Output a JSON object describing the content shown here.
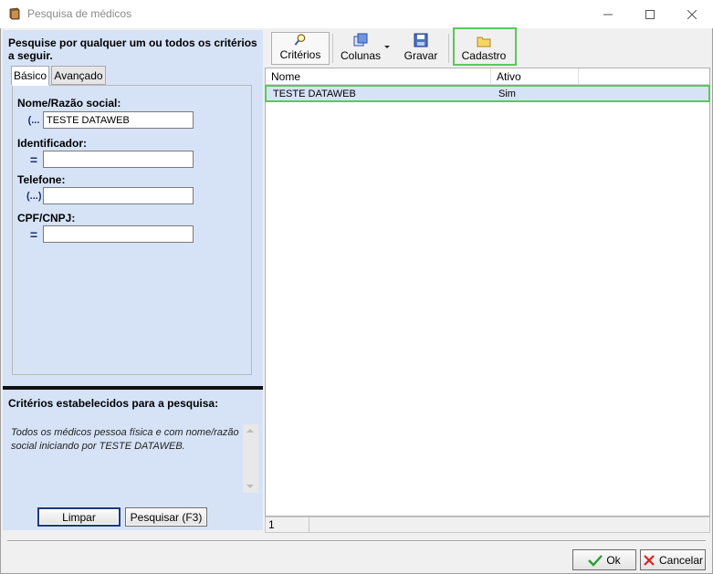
{
  "window": {
    "title": "Pesquisa de médicos",
    "icon": "book-icon"
  },
  "left": {
    "instructions": "Pesquise por qualquer um ou todos os critérios a seguir.",
    "tabs": [
      {
        "label": "Básico",
        "active": true
      },
      {
        "label": "Avançado",
        "active": false
      }
    ],
    "fields": [
      {
        "label": "Nome/Razão social:",
        "operator": "(...",
        "value": "TESTE DATAWEB"
      },
      {
        "label": "Identificador:",
        "operator": "=",
        "value": ""
      },
      {
        "label": "Telefone:",
        "operator": "(...)",
        "value": ""
      },
      {
        "label": "CPF/CNPJ:",
        "operator": "=",
        "value": ""
      }
    ],
    "criteria_title": "Critérios estabelecidos para a pesquisa:",
    "criteria_text": "Todos os médicos pessoa física e com nome/razão social iniciando por TESTE DATAWEB.",
    "clear_label": "Limpar",
    "search_label": "Pesquisar (F3)"
  },
  "toolbar": {
    "criteria_label": "Critérios",
    "columns_label": "Colunas",
    "save_label": "Gravar",
    "register_label": "Cadastro"
  },
  "grid": {
    "columns": [
      "Nome",
      "Ativo"
    ],
    "rows": [
      {
        "nome": "TESTE DATAWEB",
        "ativo": "Sim"
      }
    ]
  },
  "status": {
    "count": "1"
  },
  "dialog": {
    "ok_label": "Ok",
    "cancel_label": "Cancelar"
  },
  "colors": {
    "panel_bg": "#d6e3f7",
    "highlight": "#5ac85a",
    "selected_row": "#d6e3f7"
  }
}
